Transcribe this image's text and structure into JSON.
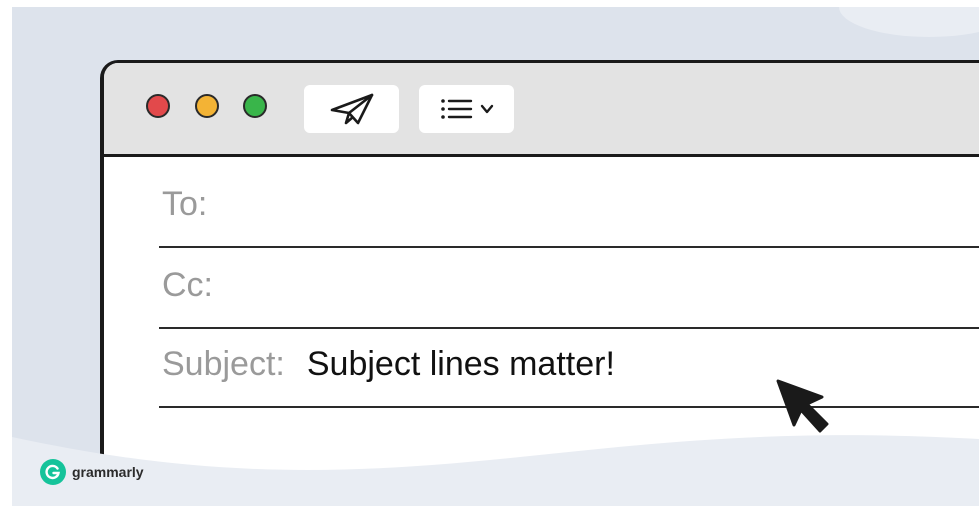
{
  "toolbar": {
    "window_controls": [
      "close",
      "minimize",
      "maximize"
    ],
    "send_icon": "paper-plane-icon",
    "format_icon": "list-format-icon",
    "format_chevron": "chevron-down-icon"
  },
  "fields": {
    "to_label": "To:",
    "to_value": "",
    "cc_label": "Cc:",
    "cc_value": "",
    "subject_label": "Subject:",
    "subject_value": "Subject lines matter!"
  },
  "brand": {
    "name": "grammarly",
    "logo_icon": "grammarly-g-icon"
  },
  "colors": {
    "background": "#dde3ec",
    "close": "#e2494b",
    "minimize": "#f3b335",
    "maximize": "#39b54a",
    "brand": "#15c39a"
  }
}
